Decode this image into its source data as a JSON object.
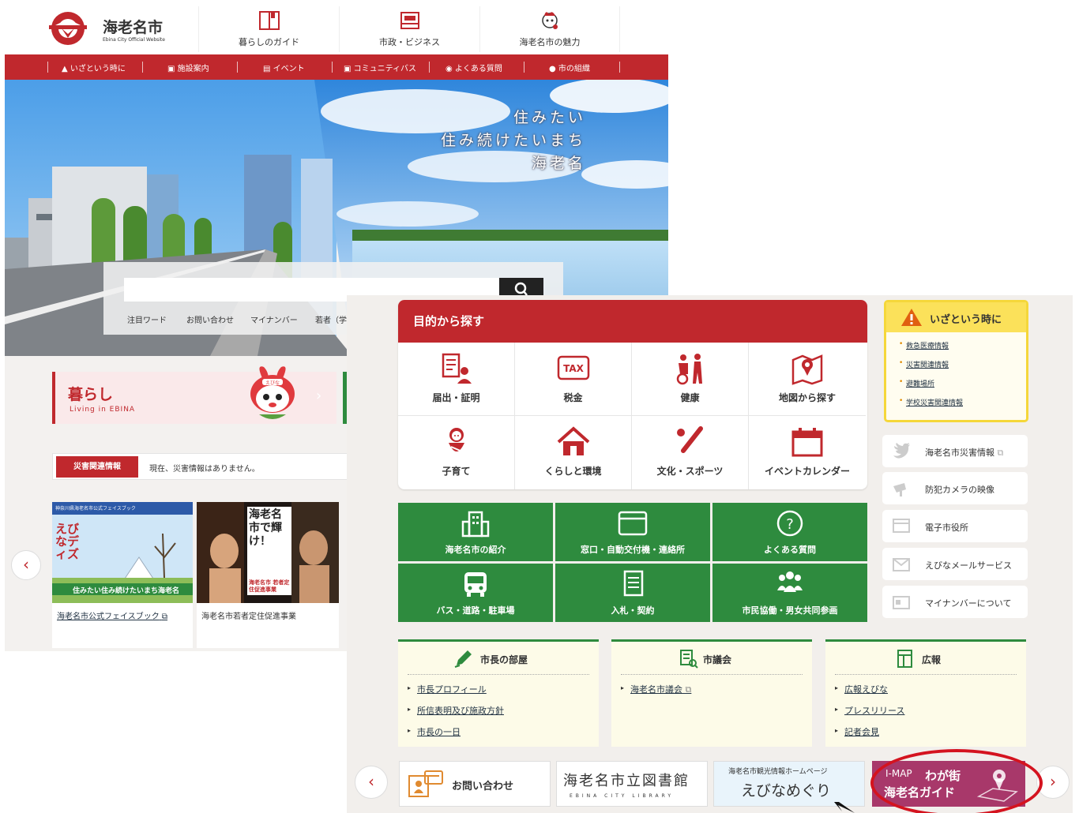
{
  "back_window": {
    "logo": {
      "name": "海老名市",
      "subtitle": "Ebina City Official Website"
    },
    "header_nav": [
      {
        "label": "暮らしのガイド",
        "icon": "book-icon"
      },
      {
        "label": "市政・ビジネス",
        "icon": "city-hall-icon"
      },
      {
        "label": "海老名市の魅力",
        "icon": "mascot-icon"
      }
    ],
    "red_bar": [
      "いざという時に",
      "施設案内",
      "イベント",
      "コミュニティバス",
      "よくある質問",
      "市の組織"
    ],
    "hero": {
      "copy": [
        "住みたい",
        "住み続けたいまち",
        "海老名"
      ]
    },
    "search": {
      "placeholder": "",
      "keywords_label": "注目ワード",
      "keywords": [
        "お問い合わせ",
        "マイナンバー",
        "若者（学"
      ]
    },
    "life_card": {
      "title": "暮らし",
      "subtitle": "Living in EBINA",
      "mascot_label": "えびな"
    },
    "disaster": {
      "tag": "災害関連情報",
      "text": "現在、災害情報はありません。"
    },
    "banners": [
      {
        "header": "神奈川県海老名市公式フェイスブック",
        "big": "えびなディズ",
        "strip": "住みたい住み続けたいまち海老名",
        "caption": "海老名市公式フェイスブック"
      },
      {
        "headline": "海老名市で輝け！",
        "small": "海老名市 若者定住促進事業",
        "caption": "海老名市若者定住促進事業"
      }
    ]
  },
  "front_window": {
    "purpose": {
      "title": "目的から探す",
      "items": [
        {
          "label": "届出・証明",
          "icon": "certificate-icon"
        },
        {
          "label": "税金",
          "icon": "tax-icon",
          "badge": "TAX"
        },
        {
          "label": "健康",
          "icon": "health-icon"
        },
        {
          "label": "地図から探す",
          "icon": "map-icon"
        },
        {
          "label": "子育て",
          "icon": "baby-icon"
        },
        {
          "label": "くらしと環境",
          "icon": "house-icon"
        },
        {
          "label": "文化・スポーツ",
          "icon": "baseball-icon"
        },
        {
          "label": "イベントカレンダー",
          "icon": "calendar-icon"
        }
      ]
    },
    "green_buttons": [
      {
        "label": "海老名市の紹介",
        "icon": "building-icon"
      },
      {
        "label": "窓口・自動交付機・連絡所",
        "icon": "window-icon"
      },
      {
        "label": "よくある質問",
        "icon": "question-icon"
      },
      {
        "label": "バス・道路・駐車場",
        "icon": "bus-icon"
      },
      {
        "label": "入札・契約",
        "icon": "document-icon"
      },
      {
        "label": "市民協働・男女共同参画",
        "icon": "people-icon"
      }
    ],
    "emergency": {
      "title": "いざという時に",
      "links": [
        "救急医療情報",
        "災害関連情報",
        "避難場所",
        "学校災害関連情報"
      ]
    },
    "side_buttons": [
      {
        "label": "海老名市災害情報",
        "icon": "twitter-icon"
      },
      {
        "label": "防犯カメラの映像",
        "icon": "camera-icon"
      },
      {
        "label": "電子市役所",
        "icon": "monitor-icon"
      },
      {
        "label": "えびなメールサービス",
        "icon": "mail-icon"
      },
      {
        "label": "マイナンバーについて",
        "icon": "card-icon"
      }
    ],
    "info_boxes": [
      {
        "title": "市長の部屋",
        "icon": "pen-icon",
        "links": [
          "市長プロフィール",
          "所信表明及び施政方針",
          "市長の一日"
        ]
      },
      {
        "title": "市議会",
        "icon": "assembly-icon",
        "links": [
          "海老名市議会"
        ]
      },
      {
        "title": "広報",
        "icon": "newsletter-icon",
        "links": [
          "広報えびな",
          "プレスリリース",
          "記者会見"
        ]
      }
    ],
    "bottom_banners": [
      {
        "label": "お問い合わせ",
        "icon": "contact-icon"
      },
      {
        "label": "海老名市立図書館",
        "sub": "EBINA CITY LIBRARY"
      },
      {
        "top": "海老名市観光情報ホームページ",
        "label": "えびなめぐり"
      },
      {
        "prefix": "I-MAP",
        "label1": "わが街",
        "label2": "海老名ガイド"
      }
    ]
  },
  "colors": {
    "brand_red": "#c0282d",
    "green": "#2e8b3e",
    "yellow": "#fbe15a",
    "highlight": "#d4131f"
  }
}
